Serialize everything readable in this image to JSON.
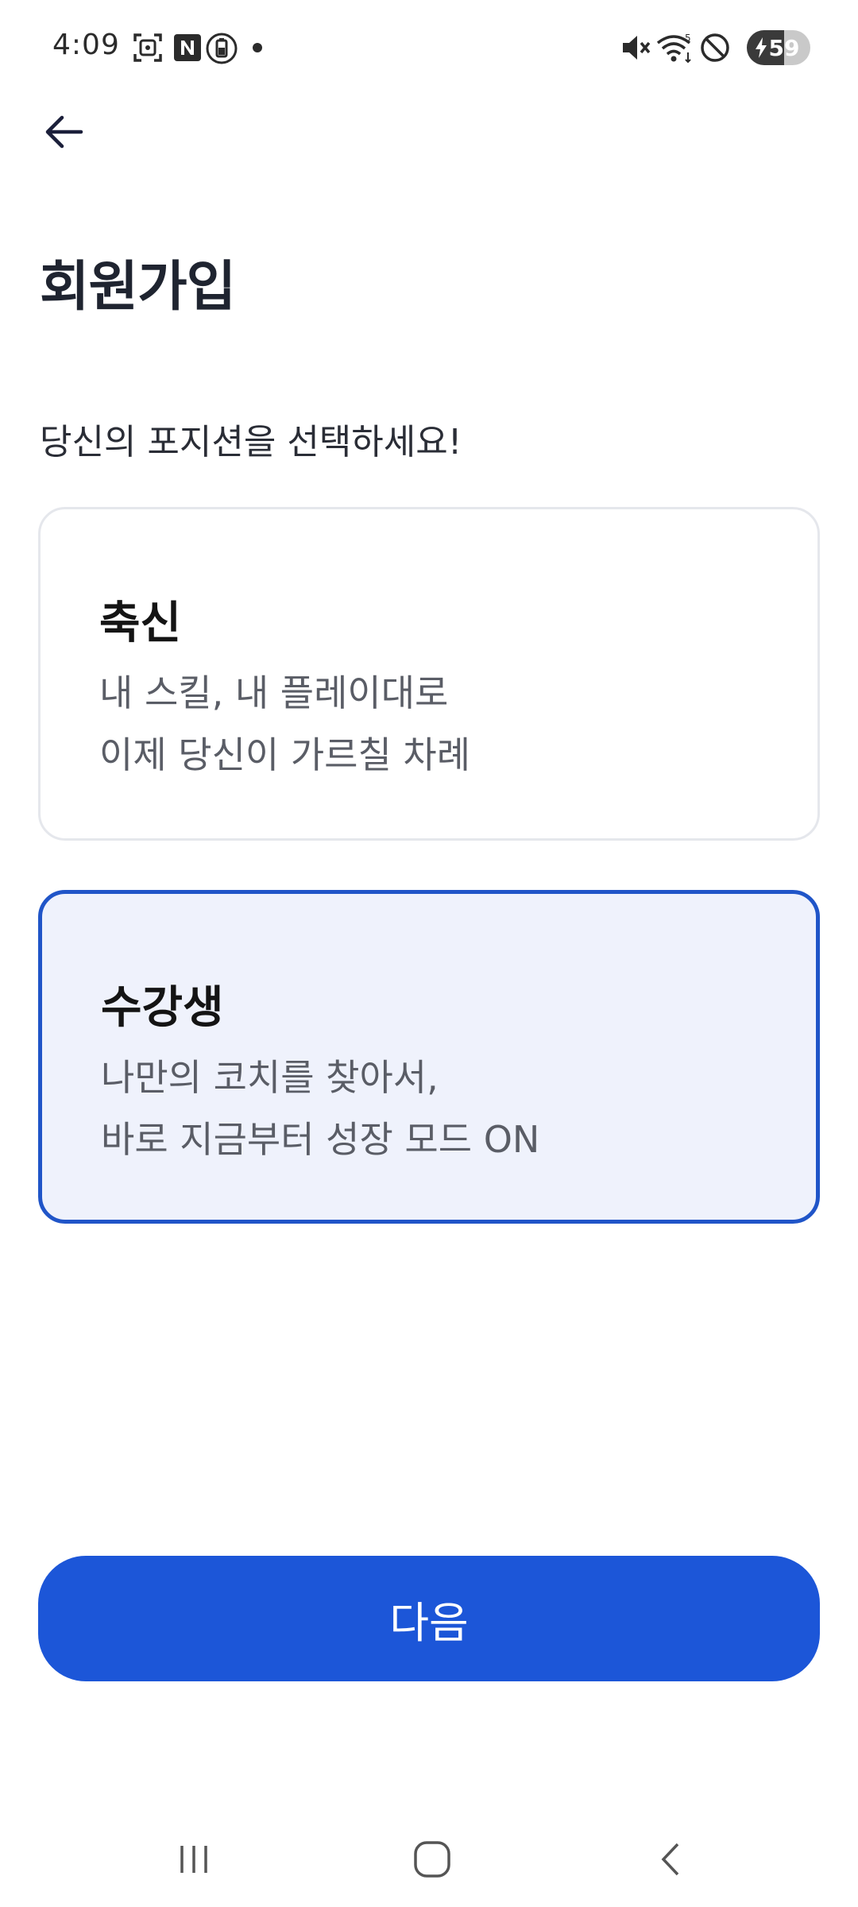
{
  "status_bar": {
    "time": "4:09",
    "battery_level": "59",
    "icons": [
      "screenshot-icon",
      "n-app-icon",
      "battery-saver-icon",
      "notification-dot",
      "mute-icon",
      "wifi-icon",
      "do-not-disturb-icon",
      "battery-charging-icon"
    ]
  },
  "header": {
    "back_icon": "arrow-left-icon",
    "title": "회원가입"
  },
  "prompt": "당신의 포지션을 선택하세요!",
  "options": [
    {
      "title": "축신",
      "desc_line1": "내 스킬, 내 플레이대로",
      "desc_line2": "이제 당신이 가르칠 차례",
      "selected": false
    },
    {
      "title": "수강생",
      "desc_line1": "나만의 코치를 찾아서,",
      "desc_line2": "바로 지금부터 성장 모드 ON",
      "selected": true
    }
  ],
  "next_button": {
    "label": "다음"
  },
  "colors": {
    "accent": "#1c56d8",
    "selected_border": "#2055c8",
    "selected_bg": "#eff2fc",
    "card_border": "#e5e7ec"
  },
  "nav_bar": {
    "icons": [
      "recent-apps-icon",
      "home-icon",
      "back-nav-icon"
    ]
  }
}
